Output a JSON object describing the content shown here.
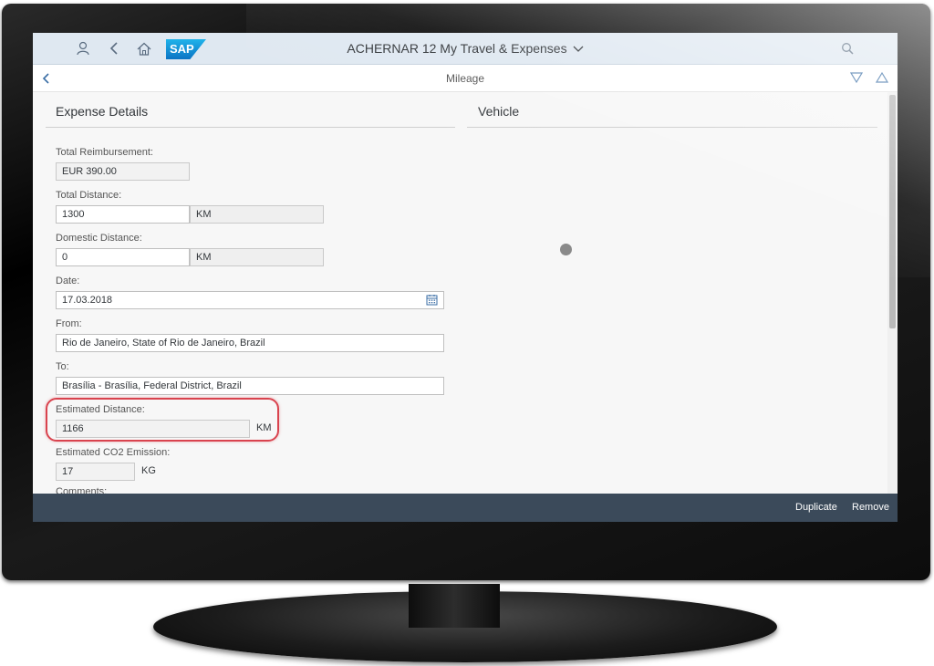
{
  "shell": {
    "title": "ACHERNAR 12 My Travel & Expenses",
    "logo_text": "SAP",
    "icons": [
      "user-icon",
      "back-icon",
      "home-icon",
      "search-icon",
      "chevron-down-icon"
    ]
  },
  "subheader": {
    "title": "Mileage",
    "icons": [
      "back-icon",
      "triangle-down-icon",
      "triangle-up-icon"
    ]
  },
  "expense_details": {
    "heading": "Expense Details",
    "total_reimbursement": {
      "label": "Total Reimbursement:",
      "value": "EUR 390.00"
    },
    "total_distance": {
      "label": "Total Distance:",
      "value": "1300",
      "unit": "KM"
    },
    "domestic_distance": {
      "label": "Domestic Distance:",
      "value": "0",
      "unit": "KM"
    },
    "date": {
      "label": "Date:",
      "value": "17.03.2018"
    },
    "from": {
      "label": "From:",
      "value": "Rio de Janeiro, State of Rio de Janeiro, Brazil"
    },
    "to": {
      "label": "To:",
      "value": "Brasília - Brasília, Federal District, Brazil"
    },
    "estimated_distance": {
      "label": "Estimated Distance:",
      "value": "1166",
      "unit": "KM"
    },
    "estimated_co2": {
      "label": "Estimated CO2 Emission:",
      "value": "17",
      "unit": "KG"
    },
    "next_label": "Comments:"
  },
  "vehicle": {
    "heading": "Vehicle"
  },
  "footer": {
    "duplicate_label": "Duplicate",
    "remove_label": "Remove"
  },
  "colors": {
    "shell_bg": "#dfe8f1",
    "footer_bg": "#3b4a5a",
    "highlight": "#d9434e",
    "accent": "#3a6ea5"
  }
}
